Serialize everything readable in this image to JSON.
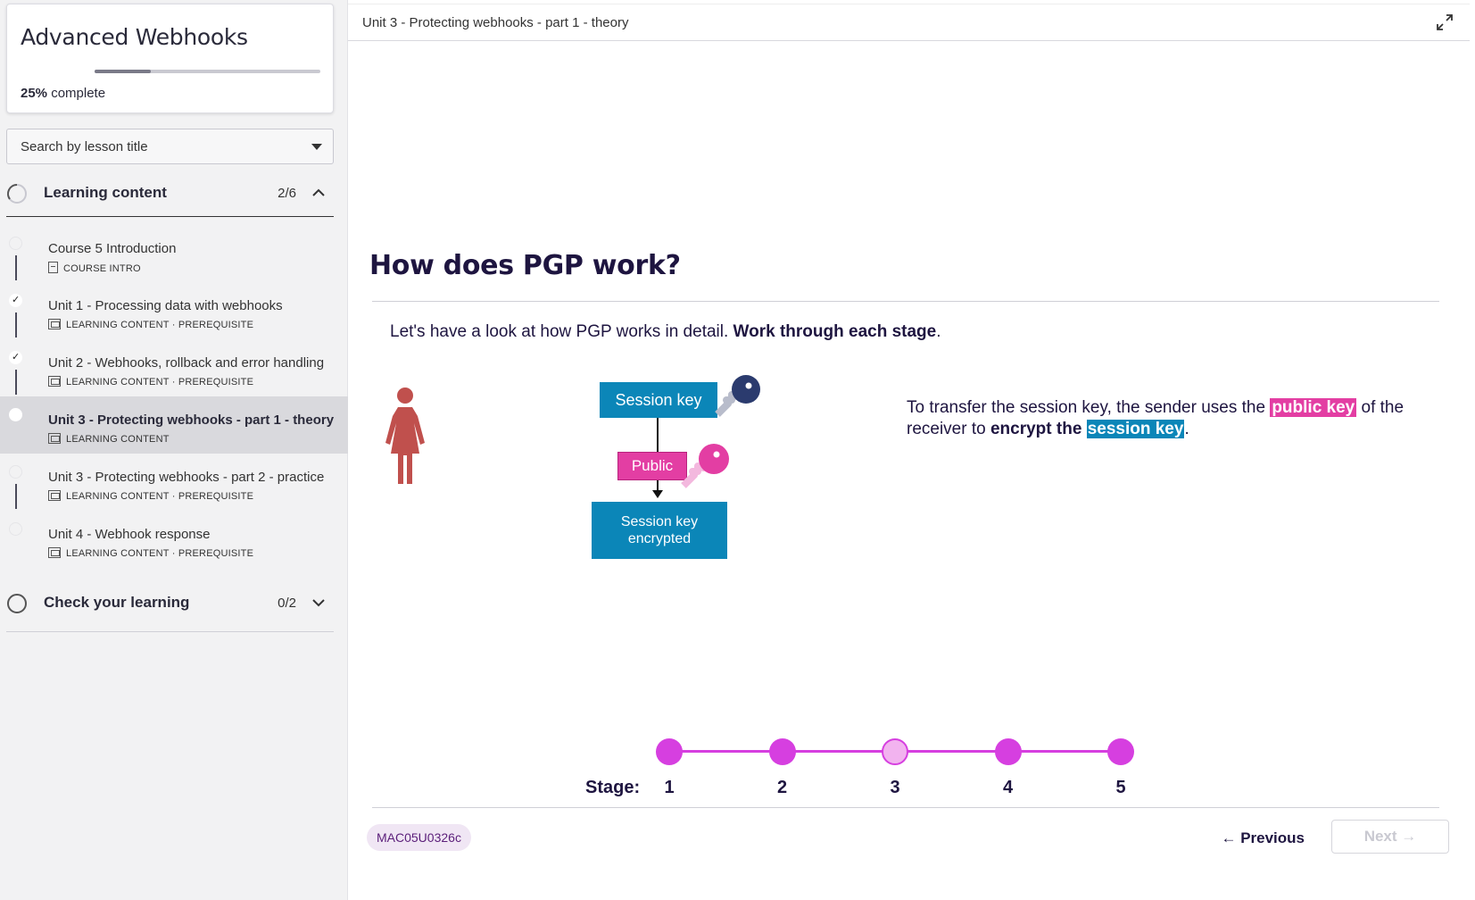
{
  "sidebar": {
    "course_title": "Advanced Webhooks",
    "progress_percent": 25,
    "progress_value_text": "25%",
    "progress_suffix": "complete",
    "search_placeholder": "Search by lesson title",
    "sections": [
      {
        "title": "Learning content",
        "count": "2/6",
        "expanded": true
      },
      {
        "title": "Check your learning",
        "count": "0/2",
        "expanded": false
      }
    ],
    "lessons": [
      {
        "title": "Course 5 Introduction",
        "meta": "COURSE INTRO",
        "done": false,
        "active": false
      },
      {
        "title": "Unit 1 - Processing data with webhooks",
        "meta": "LEARNING CONTENT · PREREQUISITE",
        "done": true,
        "active": false
      },
      {
        "title": "Unit 2 - Webhooks, rollback and error handling",
        "meta": "LEARNING CONTENT · PREREQUISITE",
        "done": true,
        "active": false
      },
      {
        "title": "Unit 3 - Protecting webhooks - part 1 - theory",
        "meta": "LEARNING CONTENT",
        "done": false,
        "active": true
      },
      {
        "title": "Unit 3 - Protecting webhooks - part 2 - practice",
        "meta": "LEARNING CONTENT · PREREQUISITE",
        "done": false,
        "active": false
      },
      {
        "title": "Unit 4 - Webhook response",
        "meta": "LEARNING CONTENT · PREREQUISITE",
        "done": false,
        "active": false
      }
    ]
  },
  "main": {
    "unit_title": "Unit 3 - Protecting webhooks - part 1 - theory",
    "heading": "How does PGP work?",
    "intro_plain": "Let's have a look at how PGP works in detail.",
    "intro_bold": "Work through each stage",
    "intro_end": ".",
    "diagram": {
      "session_key_label": "Session key",
      "public_label": "Public",
      "encrypted_line1": "Session key",
      "encrypted_line2": "encrypted"
    },
    "explain": {
      "part1": "To transfer the session key, the sender uses the",
      "hl_public": "public key",
      "part2": " of the receiver to ",
      "bold": "encrypt the",
      "hl_session": "session key",
      "part3": "."
    },
    "stages_label": "Stage:",
    "stages": [
      "1",
      "2",
      "3",
      "4",
      "5"
    ],
    "current_stage": 3,
    "code": "MAC05U0326c",
    "prev_label": "Previous",
    "next_label": "Next"
  },
  "colors": {
    "brand_blue": "#0b86b8",
    "brand_pink": "#e33ea3",
    "stage_purple": "#d63fe0",
    "heading_navy": "#1e1540"
  }
}
